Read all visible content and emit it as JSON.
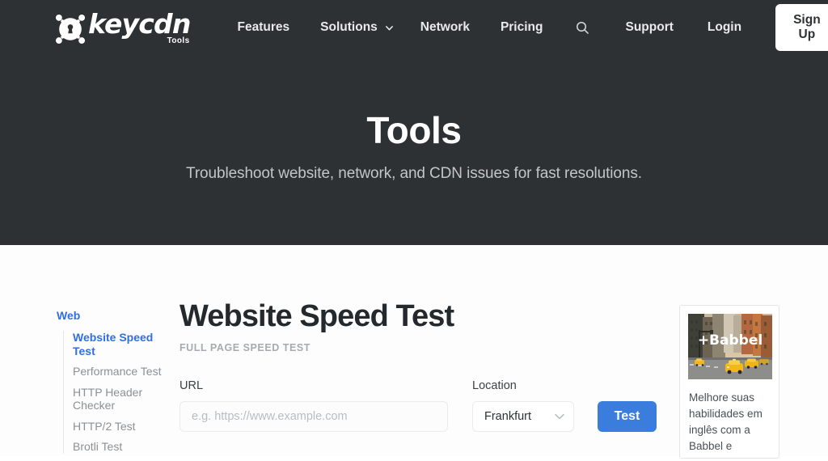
{
  "header": {
    "logo": {
      "word": "keycdn",
      "sub": "Tools",
      "icon": "keyhole-logo-icon"
    },
    "nav_left": [
      {
        "label": "Features",
        "caret": false
      },
      {
        "label": "Solutions",
        "caret": true
      },
      {
        "label": "Network",
        "caret": false
      },
      {
        "label": "Pricing",
        "caret": false
      }
    ],
    "search_icon": "search-icon",
    "nav_right": [
      {
        "label": "Support"
      },
      {
        "label": "Login"
      }
    ],
    "signup_label": "Sign Up",
    "background_color": "#2d3134"
  },
  "hero": {
    "title": "Tools",
    "subtitle": "Troubleshoot website, network, and CDN issues for fast resolutions."
  },
  "sidebar": {
    "group_title": "Web",
    "items": [
      {
        "label": "Website Speed Test",
        "active": true
      },
      {
        "label": "Performance Test",
        "active": false
      },
      {
        "label": "HTTP Header Checker",
        "active": false
      },
      {
        "label": "HTTP/2 Test",
        "active": false
      },
      {
        "label": "Brotli Test",
        "active": false
      }
    ],
    "active_color": "#2f6fe0",
    "inactive_color": "#8d9094"
  },
  "main": {
    "title": "Website Speed Test",
    "subtitle": "FULL PAGE SPEED TEST",
    "form": {
      "url_label": "URL",
      "url_value": "",
      "url_placeholder": "e.g. https://www.example.com",
      "location_label": "Location",
      "location_value": "Frankfurt",
      "location_options": [
        "Frankfurt"
      ],
      "test_button_label": "Test",
      "test_button_color": "#3b7ddd",
      "dropdown_caret_icon": "chevron-down-icon"
    }
  },
  "ad": {
    "brand": "+Babbel",
    "image_alt": "city-street-taxis-image",
    "text": "Melhore suas habilidades em inglês com a Babbel e"
  }
}
